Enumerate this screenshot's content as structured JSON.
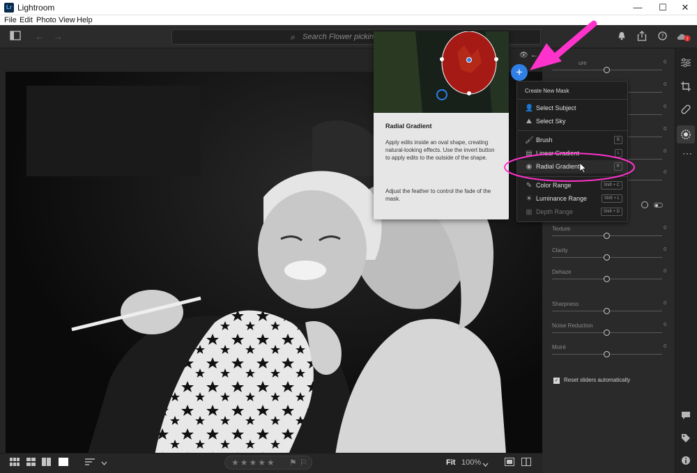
{
  "window": {
    "app_logo": "Lr",
    "title": "Lightroom",
    "minimize": "—",
    "maximize": "☐",
    "close": "✕"
  },
  "menu": [
    "File",
    "Edit",
    "Photo",
    "View",
    "Help"
  ],
  "toolbar": {
    "search_placeholder": "Search Flower picking",
    "icons": [
      "panel-toggle-icon",
      "back-arrow-icon",
      "forward-arrow-icon",
      "search-icon",
      "bell-icon",
      "share-icon",
      "help-icon",
      "cloud-sync-icon"
    ]
  },
  "tooltip": {
    "title": "Radial Gradient",
    "paragraph1": "Apply edits inside an oval shape, creating natural-looking effects. Use the invert button to apply edits to the outside of the shape.",
    "paragraph2": "Adjust the feather to control the fade of the mask."
  },
  "mask_menu": {
    "header": "Create New Mask",
    "items": [
      {
        "label": "Select Subject",
        "icon": "person-icon",
        "key": ""
      },
      {
        "label": "Select Sky",
        "icon": "sky-icon",
        "key": ""
      },
      {
        "label": "Brush",
        "icon": "brush-icon",
        "key": "B"
      },
      {
        "label": "Linear Gradient",
        "icon": "linear-gradient-icon",
        "key": "L"
      },
      {
        "label": "Radial Gradient",
        "icon": "radial-gradient-icon",
        "key": "R"
      },
      {
        "label": "Color Range",
        "icon": "color-range-icon",
        "key": "Shift + C"
      },
      {
        "label": "Luminance Range",
        "icon": "luminance-range-icon",
        "key": "Shift + L"
      },
      {
        "label": "Depth Range",
        "icon": "depth-range-icon",
        "key": "Shift + D"
      }
    ]
  },
  "panel": {
    "partial_label": "ure",
    "sliders": [
      {
        "label": "Texture",
        "value": "0"
      },
      {
        "label": "Clarity",
        "value": "0"
      },
      {
        "label": "Dehaze",
        "value": "0"
      },
      {
        "label": "Sharpness",
        "value": "0"
      },
      {
        "label": "Noise Reduction",
        "value": "0"
      },
      {
        "label": "Moiré",
        "value": "0"
      }
    ],
    "hidden_values": [
      "0",
      "0",
      "0",
      "0",
      "0",
      "0"
    ],
    "reset_label": "Reset sliders automatically",
    "reset_checked": true
  },
  "bottom": {
    "stars": "★★★★★",
    "fit": "Fit",
    "zoom": "100%"
  },
  "colors": {
    "accent": "#2f7fe6",
    "annotation": "#ff33cc",
    "mask_red": "#b01818"
  }
}
